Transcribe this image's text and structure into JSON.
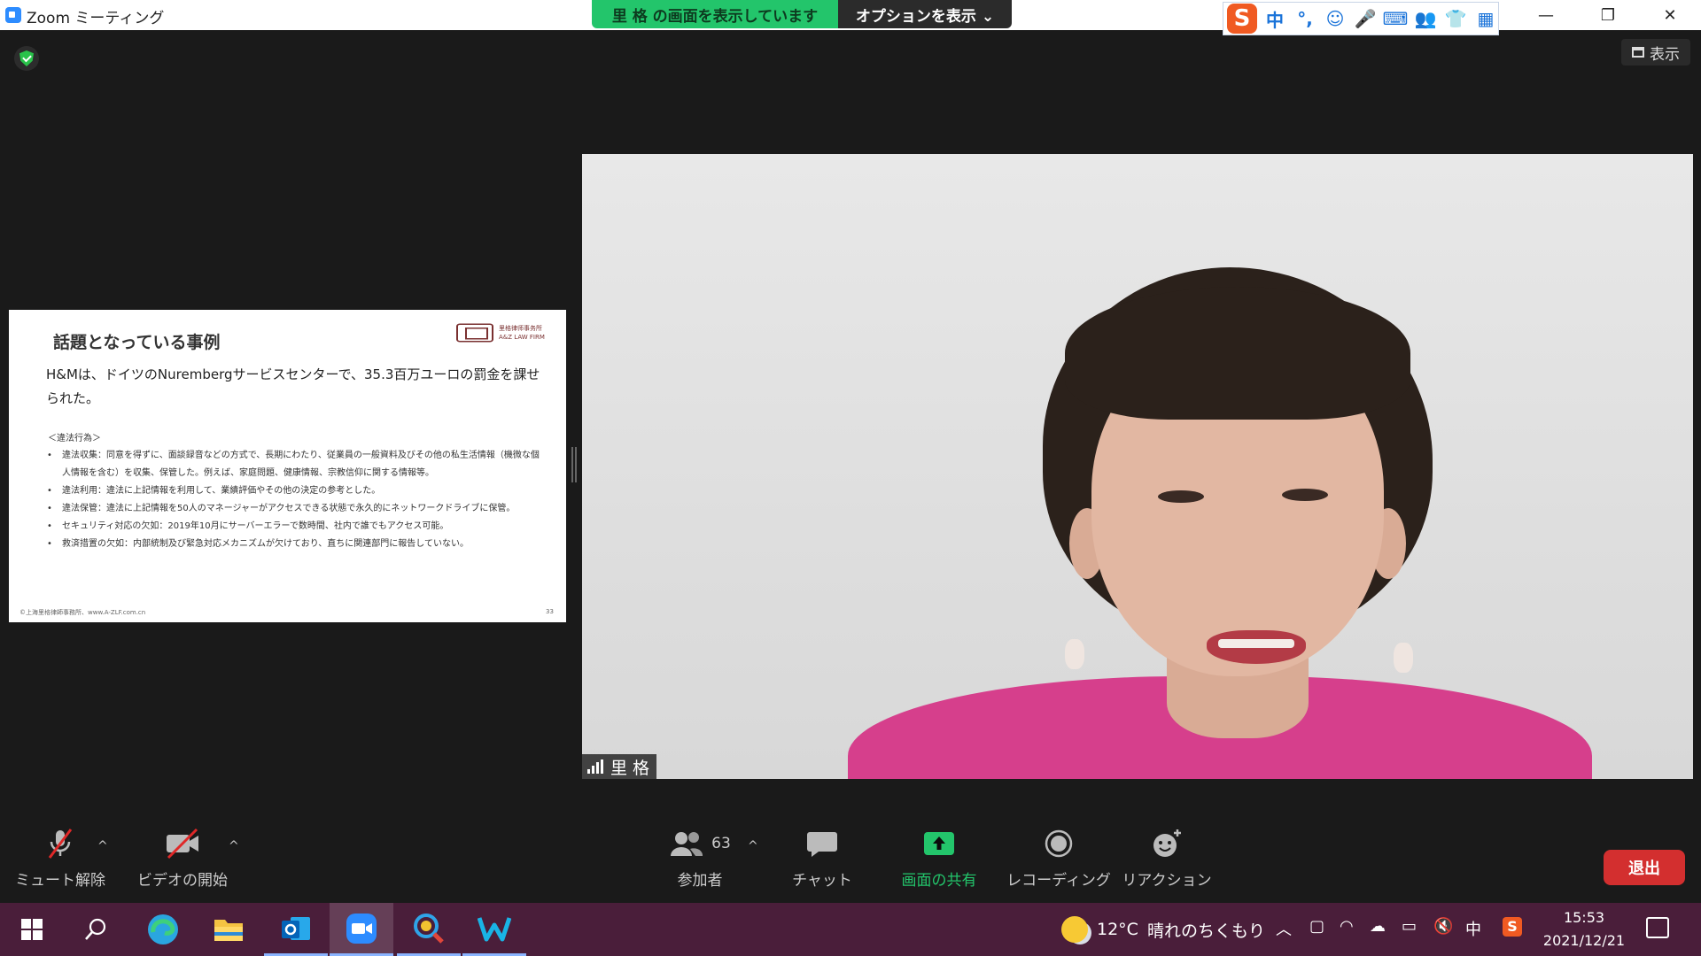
{
  "window": {
    "app_title": "Zoom ミーティング",
    "minimize": "—",
    "restore": "❐",
    "close": "✕"
  },
  "share_banner": {
    "status": "里 格 の画面を表示しています",
    "options": "オプションを表示 ⌄"
  },
  "ime": {
    "logo": "S",
    "items": [
      "中",
      "°,",
      "☺",
      "🎤",
      "⌨",
      "👥",
      "👕",
      "▦"
    ]
  },
  "view_button": {
    "label": "表示"
  },
  "slide": {
    "title": "話題となっている事例",
    "logo_text": [
      "里格律师事务所",
      "A&Z LAW FIRM"
    ],
    "lead": "H&Mは、ドイツのNurembergサービスセンターで、35.3百万ユーロの罰金を課せられた。",
    "heading": "＜違法行為＞",
    "bullets": [
      "違法収集：同意を得ずに、面談録音などの方式で、長期にわたり、従業員の一般資料及びその他の私生活情報（機微な個人情報を含む）を収集、保管した。例えば、家庭問題、健康情報、宗教信仰に関する情報等。",
      "違法利用：違法に上記情報を利用して、業績評価やその他の決定の参考とした。",
      "違法保管：違法に上記情報を50人のマネージャーがアクセスできる状態で永久的にネットワークドライブに保管。",
      "セキュリティ対応の欠如：2019年10月にサーバーエラーで数時間、社内で誰でもアクセス可能。",
      "救済措置の欠如：内部統制及び緊急対応メカニズムが欠けており、直ちに関連部門に報告していない。"
    ],
    "footer": "©上海里格律師事務所、www.A-ZLF.com.cn",
    "page": "33"
  },
  "video": {
    "participant_name": "里 格"
  },
  "controls": {
    "mute": "ミュート解除",
    "video": "ビデオの開始",
    "participants_count": "63",
    "participants": "参加者",
    "chat": "チャット",
    "share": "画面の共有",
    "record": "レコーディング",
    "reactions": "リアクション",
    "leave": "退出"
  },
  "colors": {
    "share_green": "#23c56b",
    "leave_red": "#d32f2f",
    "taskbar": "#4a1e3a"
  },
  "taskbar": {
    "weather_temp": "12°C",
    "weather_text": "晴れのちくもり",
    "ime_lang": "中",
    "time": "15:53",
    "date": "2021/12/21"
  }
}
